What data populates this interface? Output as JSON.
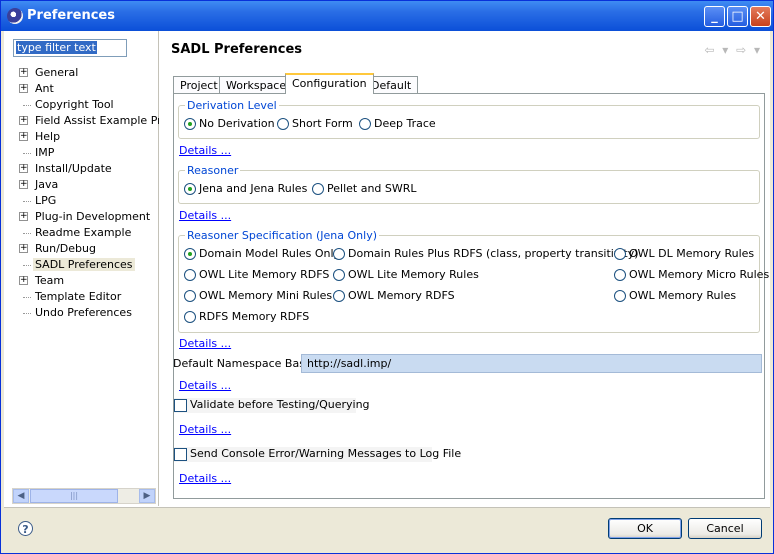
{
  "window": {
    "title": "Preferences"
  },
  "filter": {
    "placeholder": "type filter text"
  },
  "tree": {
    "items": [
      {
        "label": "General",
        "expandable": true
      },
      {
        "label": "Ant",
        "expandable": true
      },
      {
        "label": "Copyright Tool",
        "expandable": false
      },
      {
        "label": "Field Assist Example Pref",
        "expandable": true
      },
      {
        "label": "Help",
        "expandable": true
      },
      {
        "label": "IMP",
        "expandable": false
      },
      {
        "label": "Install/Update",
        "expandable": true
      },
      {
        "label": "Java",
        "expandable": true
      },
      {
        "label": "LPG",
        "expandable": false
      },
      {
        "label": "Plug-in Development",
        "expandable": true
      },
      {
        "label": "Readme Example",
        "expandable": false
      },
      {
        "label": "Run/Debug",
        "expandable": true
      },
      {
        "label": "SADL Preferences",
        "expandable": false,
        "selected": true
      },
      {
        "label": "Team",
        "expandable": true
      },
      {
        "label": "Template Editor",
        "expandable": false
      },
      {
        "label": "Undo Preferences",
        "expandable": false
      }
    ]
  },
  "page": {
    "title": "SADL Preferences"
  },
  "tabs": [
    "Project",
    "Workspace",
    "Configuration",
    "Default"
  ],
  "active_tab": "Configuration",
  "derivation": {
    "title": "Derivation Level",
    "options": [
      "No Derivation",
      "Short Form",
      "Deep Trace"
    ],
    "selected": "No Derivation"
  },
  "reasoner": {
    "title": "Reasoner",
    "options": [
      "Jena and Jena Rules",
      "Pellet and SWRL"
    ],
    "selected": "Jena and Jena Rules"
  },
  "reasoner_spec": {
    "title": "Reasoner Specification (Jena Only)",
    "options": [
      "Domain Model Rules Only",
      "Domain Rules Plus RDFS (class, property transitivity)",
      "OWL DL Memory Rules",
      "OWL Lite Memory RDFS",
      "OWL Lite Memory Rules",
      "OWL Memory Micro Rules",
      "OWL Memory Mini Rules",
      "OWL Memory RDFS",
      "OWL Memory Rules",
      "RDFS Memory RDFS"
    ],
    "selected": "Domain Model Rules Only"
  },
  "details_label": "Details ...",
  "namespace": {
    "label": "Default Namespace Base",
    "value": "http://sadl.imp/"
  },
  "validate": {
    "label": "Validate before Testing/Querying",
    "checked": false
  },
  "console": {
    "label": "Send Console Error/Warning Messages to Log File",
    "checked": false
  },
  "buttons": {
    "ok": "OK",
    "cancel": "Cancel",
    "help": "?"
  },
  "colors": {
    "title_bar": "#0b4fd8",
    "group_title": "#0046d5",
    "link": "#0000ff",
    "radio_dot": "#21a121",
    "tab_highlight": "#ffc83c"
  }
}
